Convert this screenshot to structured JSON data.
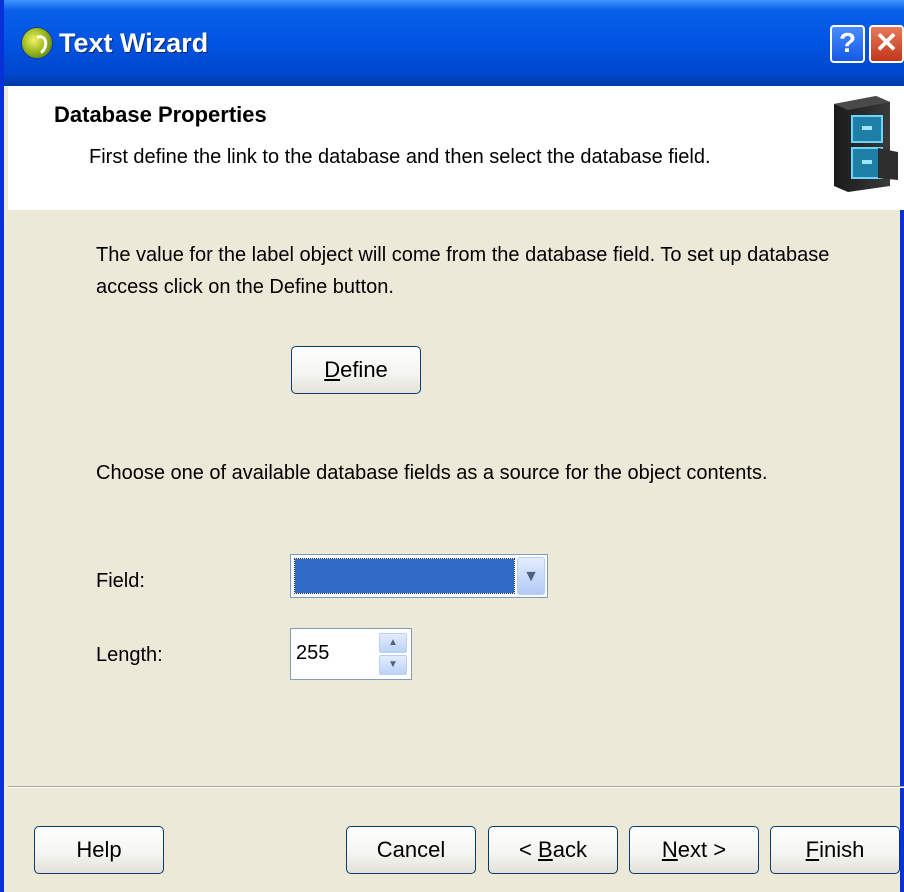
{
  "window": {
    "title": "Text Wizard",
    "help_button": "?",
    "close_button": "✕"
  },
  "header": {
    "title": "Database Properties",
    "subtitle": "First define the link to the database and then select the database field."
  },
  "body": {
    "intro_line1": "The value for the label object will come from the database field. To set up database",
    "intro_line2": "access click on the Define button.",
    "define_button": {
      "mnemonic": "D",
      "rest": "efine"
    },
    "choose_text": "Choose one of available database fields as a source for the object contents.",
    "field_label": "Field:",
    "field_value": "",
    "length_label": "Length:",
    "length_value": "255"
  },
  "footer": {
    "help": "Help",
    "cancel": "Cancel",
    "back": {
      "prefix": "< ",
      "mnemonic": "B",
      "rest": "ack"
    },
    "next": {
      "mnemonic": "N",
      "rest": "ext >"
    },
    "finish": {
      "mnemonic": "F",
      "rest": "inish"
    }
  },
  "colors": {
    "titlebar": "#0054e3",
    "dialog_bg": "#ece9d8",
    "selection": "#316ac5"
  },
  "icons": [
    "app-icon",
    "database-cabinet-icon",
    "chevron-down-icon",
    "arrow-up-icon",
    "arrow-down-icon"
  ]
}
